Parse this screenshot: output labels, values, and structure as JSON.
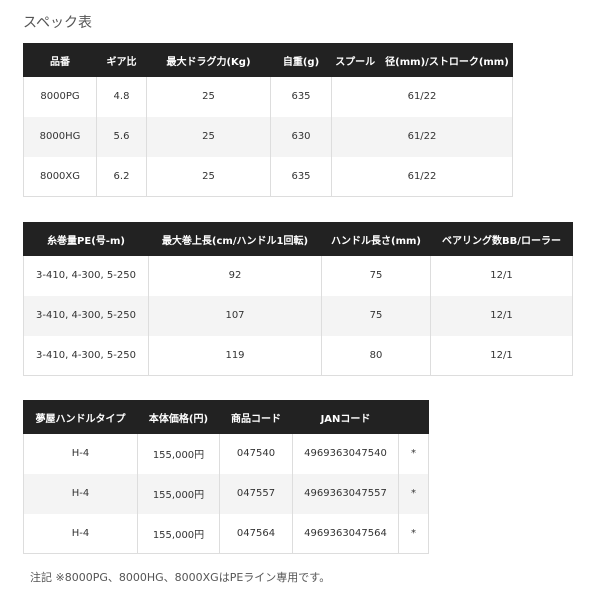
{
  "title": "スペック表",
  "table1": {
    "headers": [
      "品番",
      "ギア比",
      "最大ドラグ力(Kg)",
      "自重(g)",
      "スプール　径(mm)/ストローク(mm)"
    ],
    "rows": [
      [
        "8000PG",
        "4.8",
        "25",
        "635",
        "61/22"
      ],
      [
        "8000HG",
        "5.6",
        "25",
        "630",
        "61/22"
      ],
      [
        "8000XG",
        "6.2",
        "25",
        "635",
        "61/22"
      ]
    ]
  },
  "table2": {
    "headers": [
      "糸巻量PE(号-m)",
      "最大巻上長(cm/ハンドル1回転)",
      "ハンドル長さ(mm)",
      "ベアリング数BB/ローラー"
    ],
    "rows": [
      [
        "3-410, 4-300, 5-250",
        "92",
        "75",
        "12/1"
      ],
      [
        "3-410, 4-300, 5-250",
        "107",
        "75",
        "12/1"
      ],
      [
        "3-410, 4-300, 5-250",
        "119",
        "80",
        "12/1"
      ]
    ]
  },
  "table3": {
    "headers": [
      "夢屋ハンドルタイプ",
      "本体価格(円)",
      "商品コード",
      "JANコード",
      ""
    ],
    "rows": [
      [
        "H-4",
        "155,000円",
        "047540",
        "4969363047540",
        "*"
      ],
      [
        "H-4",
        "155,000円",
        "047557",
        "4969363047557",
        "*"
      ],
      [
        "H-4",
        "155,000円",
        "047564",
        "4969363047564",
        "*"
      ]
    ]
  },
  "note": "注記 ※8000PG、8000HG、8000XGはPEライン専用です。"
}
